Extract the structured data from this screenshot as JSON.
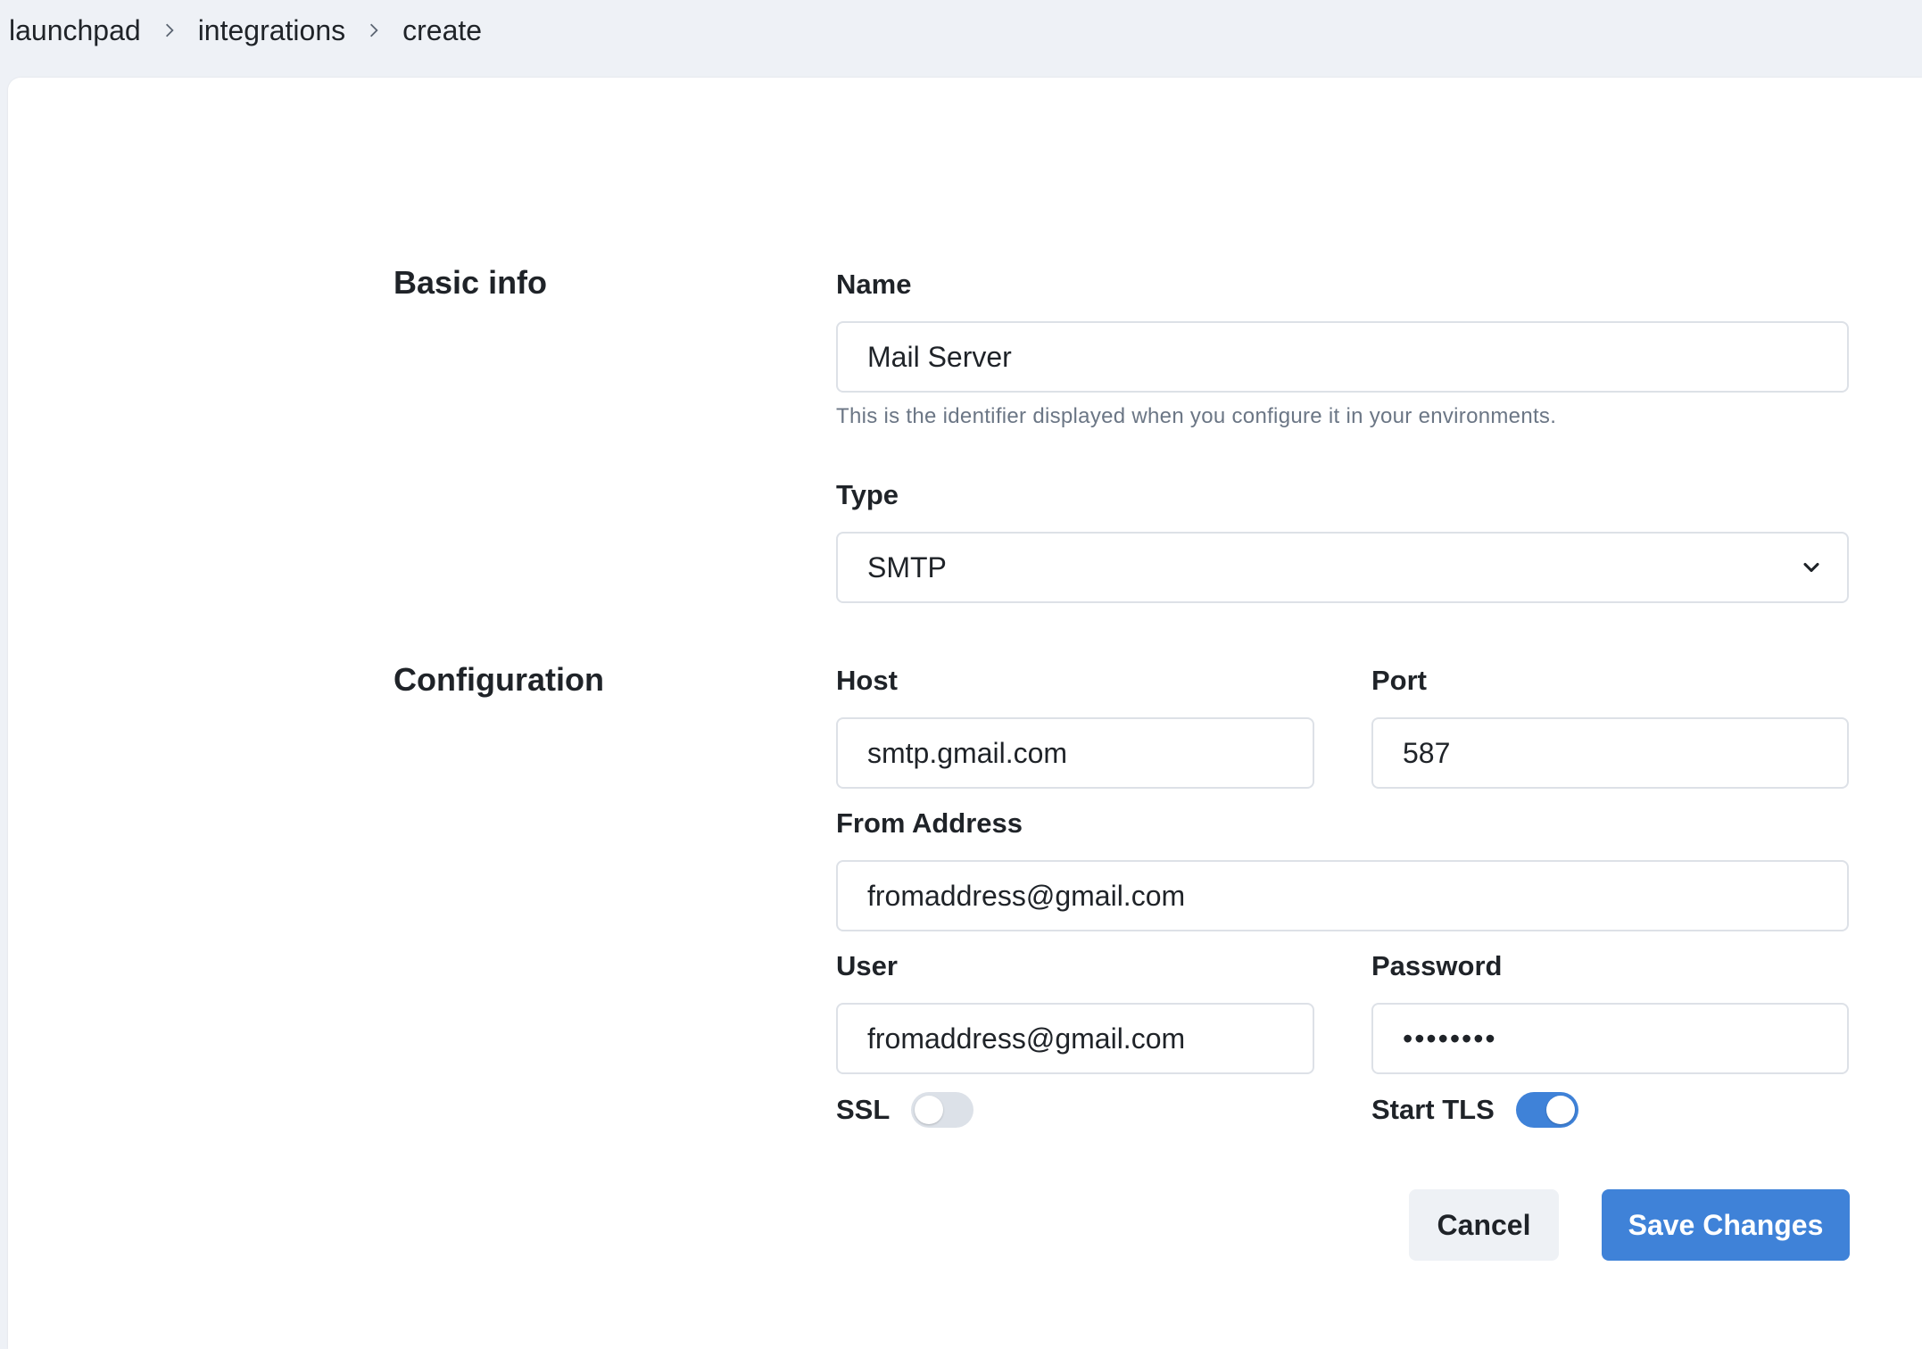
{
  "breadcrumb": {
    "items": [
      "launchpad",
      "integrations",
      "create"
    ]
  },
  "sections": {
    "basic_info": "Basic info",
    "configuration": "Configuration"
  },
  "fields": {
    "name": {
      "label": "Name",
      "value": "Mail Server",
      "helper": "This is the identifier displayed when you configure it in your environments."
    },
    "type": {
      "label": "Type",
      "value": "SMTP"
    },
    "host": {
      "label": "Host",
      "value": "smtp.gmail.com"
    },
    "port": {
      "label": "Port",
      "value": "587"
    },
    "from_address": {
      "label": "From Address",
      "value": "fromaddress@gmail.com"
    },
    "user": {
      "label": "User",
      "value": "fromaddress@gmail.com"
    },
    "password": {
      "label": "Password",
      "value": "••••••••"
    }
  },
  "toggles": {
    "ssl": {
      "label": "SSL",
      "enabled": false
    },
    "start_tls": {
      "label": "Start TLS",
      "enabled": true
    }
  },
  "buttons": {
    "cancel": "Cancel",
    "save": "Save Changes"
  },
  "colors": {
    "accent": "#3f82d8",
    "page_background": "#eef1f6",
    "toggle_off": "#dce1e8"
  }
}
